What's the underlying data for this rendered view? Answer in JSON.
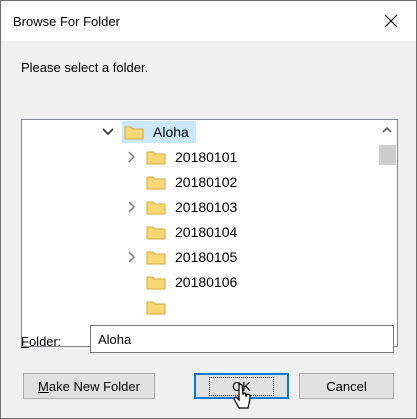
{
  "window": {
    "title": "Browse For Folder",
    "close_icon": "close-icon"
  },
  "prompt": "Please select a folder.",
  "tree": {
    "root": {
      "label": "Aloha",
      "expanded": true,
      "selected": true
    },
    "children": [
      {
        "label": "20180101",
        "has_children": true
      },
      {
        "label": "20180102",
        "has_children": false
      },
      {
        "label": "20180103",
        "has_children": true
      },
      {
        "label": "20180104",
        "has_children": false
      },
      {
        "label": "20180105",
        "has_children": true
      },
      {
        "label": "20180106",
        "has_children": false
      }
    ]
  },
  "folder_field": {
    "label_prefix": "F",
    "label_rest": "older:",
    "value": "Aloha"
  },
  "buttons": {
    "make_new_folder": {
      "underline": "M",
      "rest": "ake New Folder"
    },
    "ok": "OK",
    "cancel": "Cancel"
  },
  "colors": {
    "selection": "#cce8ff",
    "folder": "#f8d775",
    "focus": "#0078d7"
  }
}
